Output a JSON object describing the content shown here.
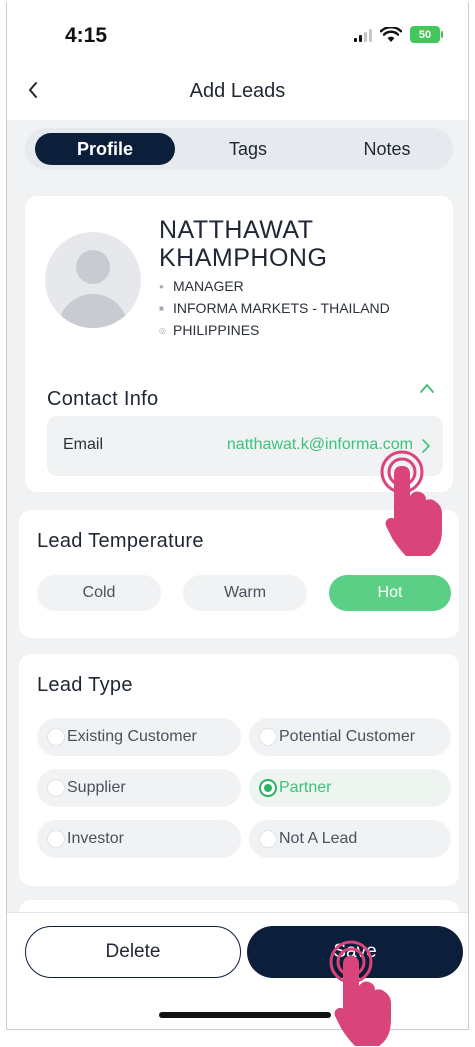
{
  "status_bar": {
    "time": "4:15",
    "battery": "50"
  },
  "nav": {
    "title": "Add Leads"
  },
  "tabs": [
    {
      "label": "Profile",
      "active": true
    },
    {
      "label": "Tags",
      "active": false
    },
    {
      "label": "Notes",
      "active": false
    }
  ],
  "profile": {
    "name_line1": "NATTHAWAT",
    "name_line2": "KHAMPHONG",
    "position": "MANAGER",
    "company": "INFORMA MARKETS - THAILAND",
    "country": "PHILIPPINES"
  },
  "contact": {
    "title": "Contact Info",
    "email_label": "Email",
    "email_value": "natthawat.k@informa.com"
  },
  "temperature": {
    "title": "Lead Temperature",
    "options": [
      "Cold",
      "Warm",
      "Hot"
    ],
    "selected": "Hot"
  },
  "lead_type": {
    "title": "Lead Type",
    "options": [
      "Existing Customer",
      "Potential Customer",
      "Supplier",
      "Partner",
      "Investor",
      "Not A Lead"
    ],
    "selected": "Partner"
  },
  "actions": {
    "delete_label": "Delete",
    "save_label": "Save"
  },
  "colors": {
    "accent_green": "#5bcf86",
    "navy": "#0b1e3a",
    "tap_pink": "#d9457a"
  }
}
